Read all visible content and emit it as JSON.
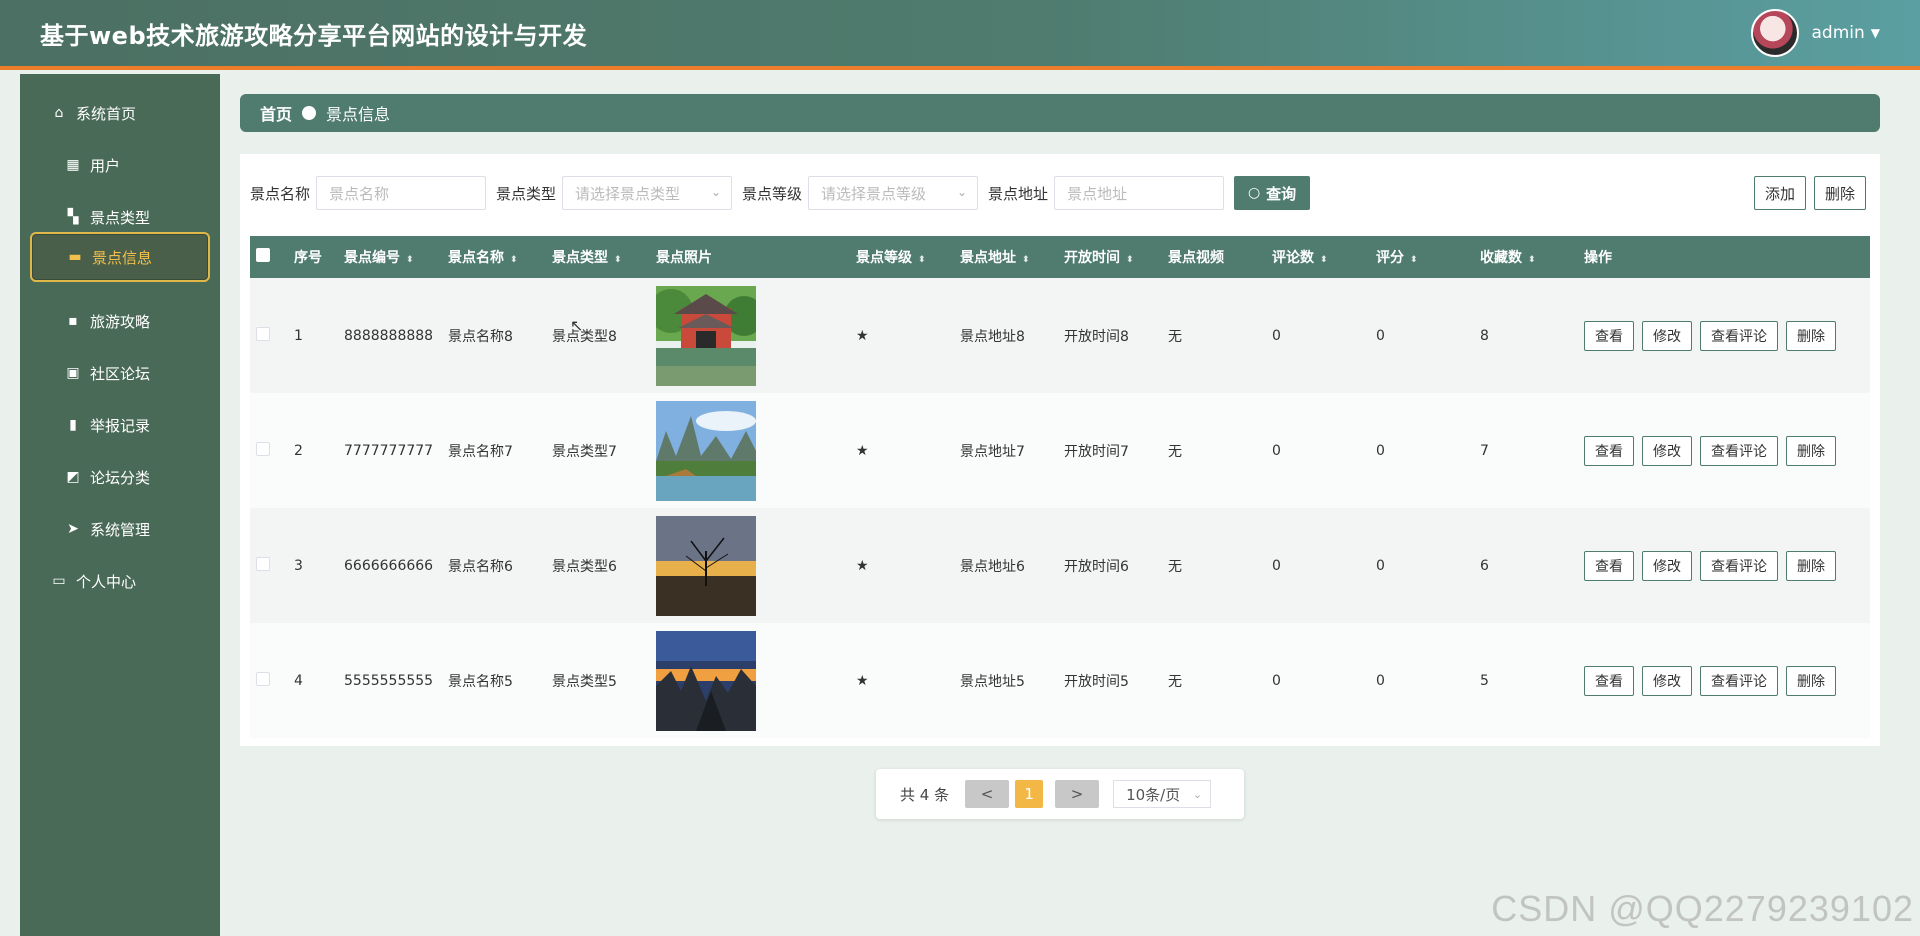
{
  "header": {
    "title": "基于web技术旅游攻略分享平台网站的设计与开发",
    "username": "admin"
  },
  "sidebar": {
    "items": [
      {
        "label": "系统首页",
        "icon": "home-icon",
        "glyph": "⌂",
        "active": false
      },
      {
        "label": "用户",
        "icon": "table-icon",
        "glyph": "▦",
        "active": false
      },
      {
        "label": "景点类型",
        "icon": "grid-icon",
        "glyph": "▚",
        "active": false
      },
      {
        "label": "景点信息",
        "icon": "ticket-icon",
        "glyph": "▬",
        "active": true
      },
      {
        "label": "旅游攻略",
        "icon": "comment-icon",
        "glyph": "▪",
        "active": false
      },
      {
        "label": "社区论坛",
        "icon": "briefcase-icon",
        "glyph": "▣",
        "active": false
      },
      {
        "label": "举报记录",
        "icon": "bar-chart-icon",
        "glyph": "▮",
        "active": false
      },
      {
        "label": "论坛分类",
        "icon": "line-chart-icon",
        "glyph": "◩",
        "active": false
      },
      {
        "label": "系统管理",
        "icon": "send-icon",
        "glyph": "➤",
        "active": false
      },
      {
        "label": "个人中心",
        "icon": "card-icon",
        "glyph": "▭",
        "active": false
      }
    ]
  },
  "breadcrumb": {
    "home": "首页",
    "current": "景点信息"
  },
  "filters": {
    "name_label": "景点名称",
    "name_placeholder": "景点名称",
    "type_label": "景点类型",
    "type_placeholder": "请选择景点类型",
    "level_label": "景点等级",
    "level_placeholder": "请选择景点等级",
    "addr_label": "景点地址",
    "addr_placeholder": "景点地址",
    "query_label": "查询",
    "add_label": "添加",
    "delete_label": "删除"
  },
  "table": {
    "headers": [
      "序号",
      "景点编号",
      "景点名称",
      "景点类型",
      "景点照片",
      "景点等级",
      "景点地址",
      "开放时间",
      "景点视频",
      "评论数",
      "评分",
      "收藏数",
      "操作"
    ],
    "actions": [
      "查看",
      "修改",
      "查看评论",
      "删除"
    ],
    "rows": [
      {
        "idx": "1",
        "code": "8888888888",
        "name": "景点名称8",
        "type": "景点类型8",
        "level": "★",
        "addr": "景点地址8",
        "open": "开放时间8",
        "video": "无",
        "comments": "0",
        "score": "0",
        "fav": "8",
        "photo": "pavilion"
      },
      {
        "idx": "2",
        "code": "7777777777",
        "name": "景点名称7",
        "type": "景点类型7",
        "level": "★",
        "addr": "景点地址7",
        "open": "开放时间7",
        "video": "无",
        "comments": "0",
        "score": "0",
        "fav": "7",
        "photo": "karst"
      },
      {
        "idx": "3",
        "code": "6666666666",
        "name": "景点名称6",
        "type": "景点类型6",
        "level": "★",
        "addr": "景点地址6",
        "open": "开放时间6",
        "video": "无",
        "comments": "0",
        "score": "0",
        "fav": "6",
        "photo": "tree"
      },
      {
        "idx": "4",
        "code": "5555555555",
        "name": "景点名称5",
        "type": "景点类型5",
        "level": "★",
        "addr": "景点地址5",
        "open": "开放时间5",
        "video": "无",
        "comments": "0",
        "score": "0",
        "fav": "5",
        "photo": "mountains"
      }
    ]
  },
  "pagination": {
    "total": "共 4 条",
    "prev": "<",
    "current": "1",
    "next": ">",
    "page_size": "10条/页"
  },
  "watermark": "CSDN @QQ2279239102",
  "colors": {
    "primary": "#4f7c6f",
    "accent": "#ee7d2b",
    "active_text": "#f2c04c",
    "page_current": "#f3b746"
  }
}
